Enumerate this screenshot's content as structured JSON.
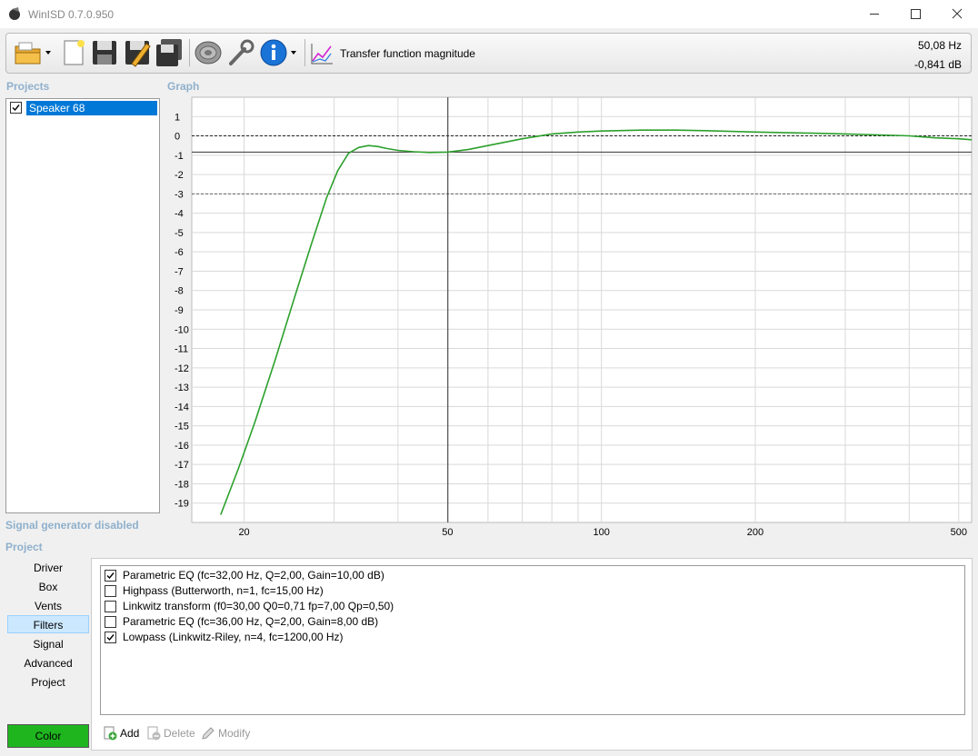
{
  "window": {
    "title": "WinISD 0.7.0.950"
  },
  "toolbar": {
    "transfer_function_label": "Transfer function magnitude",
    "frequency_readout": "50,08 Hz",
    "db_readout": "-0,841 dB",
    "icons": [
      "open-folder-icon",
      "new-document-icon",
      "save-icon",
      "save-as-icon",
      "save-all-icon",
      "speaker-icon",
      "wrench-icon",
      "info-icon",
      "graph-icon"
    ]
  },
  "projects": {
    "header": "Projects",
    "items": [
      {
        "label": "Speaker 68",
        "checked": true,
        "selected": true
      }
    ]
  },
  "graph": {
    "header": "Graph",
    "cursor_frequency": 50.08,
    "ref_lines_db": [
      0,
      -3
    ]
  },
  "chart_data": {
    "type": "line",
    "title": "",
    "xlabel": "",
    "ylabel": "",
    "x_scale": "log",
    "xlim": [
      15.8,
      530
    ],
    "ylim": [
      -20,
      2
    ],
    "x_tick_labels": [
      "20",
      "50",
      "100",
      "200",
      "500"
    ],
    "y_tick_labels": [
      "1",
      "0",
      "-1",
      "-2",
      "-3",
      "-4",
      "-5",
      "-6",
      "-7",
      "-8",
      "-9",
      "-10",
      "-11",
      "-12",
      "-13",
      "-14",
      "-15",
      "-16",
      "-17",
      "-18",
      "-19"
    ],
    "series": [
      {
        "color": "#2ca02c",
        "x": [
          18,
          19.5,
          21,
          23,
          25,
          27,
          29,
          30.5,
          32,
          33.5,
          35,
          36.5,
          38,
          40,
          43,
          46,
          50,
          55,
          60,
          70,
          80,
          90,
          100,
          120,
          140,
          160,
          200,
          250,
          300,
          350,
          400,
          450,
          500,
          530
        ],
        "y": [
          -19.6,
          -17.2,
          -14.8,
          -11.6,
          -8.5,
          -5.7,
          -3.2,
          -1.8,
          -0.9,
          -0.6,
          -0.5,
          -0.55,
          -0.65,
          -0.75,
          -0.82,
          -0.86,
          -0.84,
          -0.7,
          -0.5,
          -0.15,
          0.1,
          0.2,
          0.25,
          0.3,
          0.3,
          0.27,
          0.2,
          0.15,
          0.1,
          0.05,
          0.0,
          -0.1,
          -0.15,
          -0.2
        ]
      }
    ],
    "grid": true
  },
  "signal_generator": {
    "status": "Signal generator disabled"
  },
  "project_section": {
    "header": "Project",
    "nav": [
      "Driver",
      "Box",
      "Vents",
      "Filters",
      "Signal",
      "Advanced",
      "Project"
    ],
    "selected_nav": "Filters",
    "color_button": "Color",
    "color_value": "#1fb51f"
  },
  "filters": {
    "items": [
      {
        "label": "Parametric EQ (fc=32,00 Hz, Q=2,00, Gain=10,00 dB)",
        "checked": true
      },
      {
        "label": "Highpass (Butterworth, n=1, fc=15,00 Hz)",
        "checked": false
      },
      {
        "label": "Linkwitz transform (f0=30,00 Q0=0,71 fp=7,00 Qp=0,50)",
        "checked": false
      },
      {
        "label": "Parametric EQ (fc=36,00 Hz, Q=2,00, Gain=8,00 dB)",
        "checked": false
      },
      {
        "label": "Lowpass (Linkwitz-Riley, n=4, fc=1200,00 Hz)",
        "checked": true
      }
    ],
    "add_label": "Add",
    "delete_label": "Delete",
    "modify_label": "Modify"
  }
}
